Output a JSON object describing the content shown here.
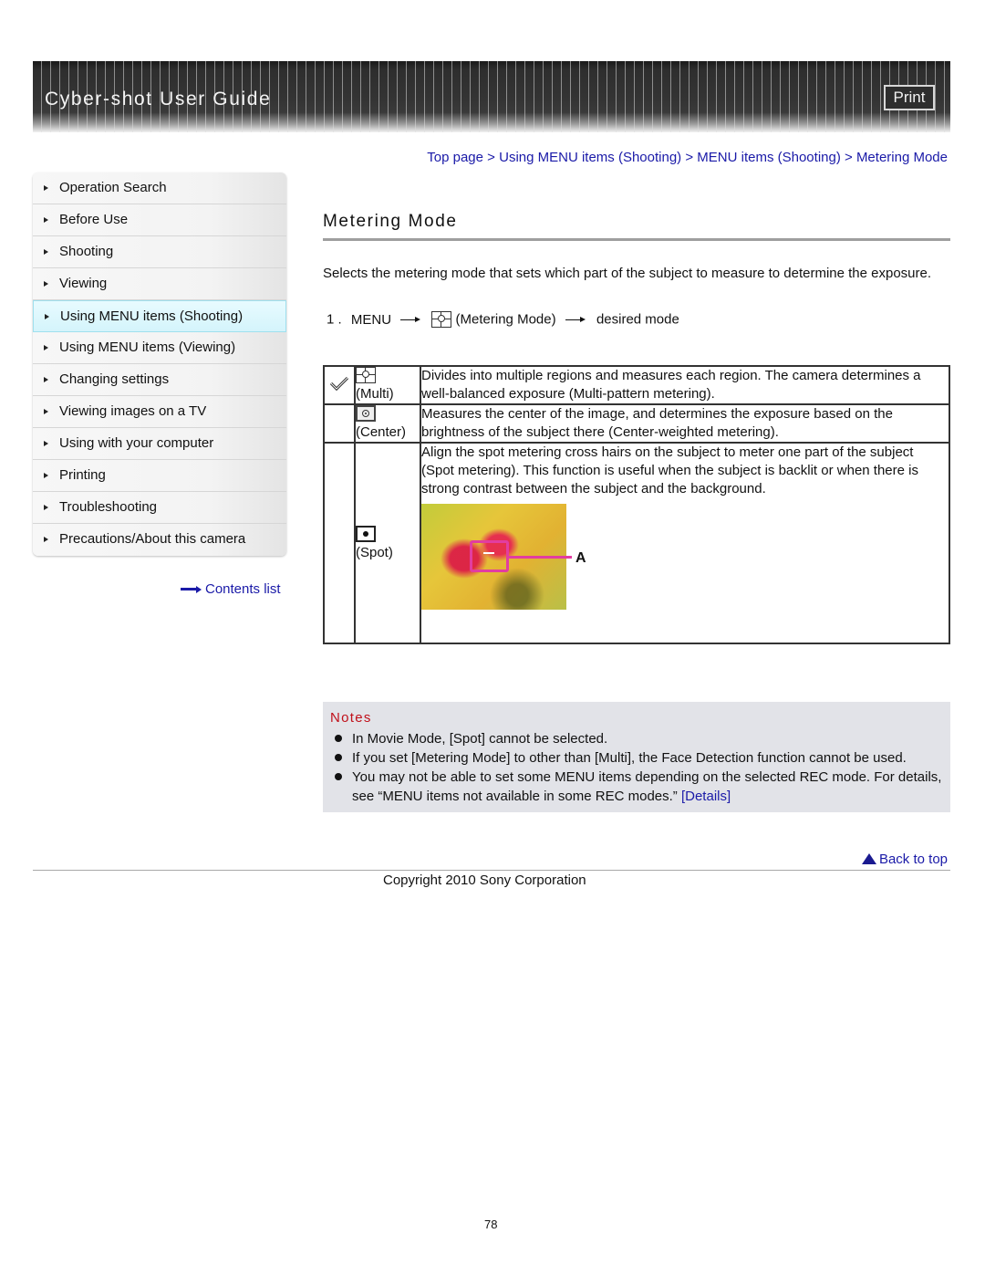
{
  "header": {
    "title": "Cyber-shot User Guide",
    "print_label": "Print"
  },
  "sidebar": {
    "items": [
      {
        "label": "Operation Search",
        "active": false
      },
      {
        "label": "Before Use",
        "active": false
      },
      {
        "label": "Shooting",
        "active": false
      },
      {
        "label": "Viewing",
        "active": false
      },
      {
        "label": "Using MENU items (Shooting)",
        "active": true
      },
      {
        "label": "Using MENU items (Viewing)",
        "active": false
      },
      {
        "label": "Changing settings",
        "active": false
      },
      {
        "label": "Viewing images on a TV",
        "active": false
      },
      {
        "label": "Using with your computer",
        "active": false
      },
      {
        "label": "Printing",
        "active": false
      },
      {
        "label": "Troubleshooting",
        "active": false
      },
      {
        "label": "Precautions/About this camera",
        "active": false
      }
    ],
    "contents_link": "Contents list"
  },
  "breadcrumb": {
    "items": [
      "Top page",
      "Using MENU items (Shooting)",
      "MENU items (Shooting)",
      "Metering Mode"
    ],
    "separator": " > "
  },
  "page": {
    "title": "Metering Mode",
    "intro": "Selects the metering mode that sets which part of the subject to measure to determine the exposure.",
    "step": {
      "number": "1 .",
      "menu": "MENU",
      "item": "(Metering Mode)",
      "target": "desired mode"
    }
  },
  "modes": [
    {
      "icon": "multi-metering-icon",
      "caption": "(Multi)",
      "default": true,
      "description": "Divides into multiple regions and measures each region. The camera determines a well-balanced exposure (Multi-pattern metering)."
    },
    {
      "icon": "center-metering-icon",
      "caption": "(Center)",
      "default": false,
      "description": "Measures the center of the image, and determines the exposure based on the brightness of the subject there (Center-weighted metering)."
    },
    {
      "icon": "spot-metering-icon",
      "caption": "(Spot)",
      "default": false,
      "description": "Align the spot metering cross hairs on the subject to meter one part of the subject (Spot metering). This function is useful when the subject is backlit or when there is strong contrast between the subject and the background.",
      "figure_label": "A"
    }
  ],
  "notes": {
    "title": "Notes",
    "items": [
      "In Movie Mode, [Spot] cannot be selected.",
      "If you set [Metering Mode] to other than [Multi], the Face Detection function cannot be used.",
      "You may not be able to set some MENU items depending on the selected REC mode. For details, see “MENU items not available in some REC modes.”"
    ],
    "details_link": "[Details]"
  },
  "footer": {
    "back_to_top": "Back to top",
    "copyright": "Copyright 2010 Sony Corporation",
    "page_number": "78"
  },
  "colors": {
    "link": "#1a1aa8",
    "notes_title": "#c0101a",
    "notes_bg": "#e2e3e8",
    "active_nav_bg": "#d4f4fb",
    "spot_frame": "#e23da0"
  }
}
